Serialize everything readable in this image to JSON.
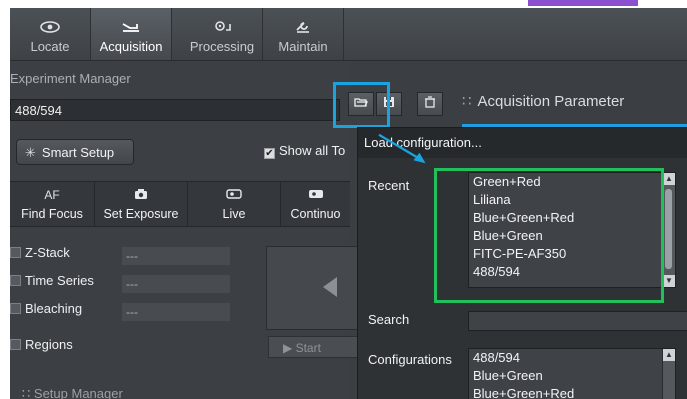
{
  "tabs": [
    {
      "label": "Locate",
      "icon": "eye-icon"
    },
    {
      "label": "Acquisition",
      "icon": "camera-arrow-icon"
    },
    {
      "label": "Processing",
      "icon": "gears-icon"
    },
    {
      "label": "Maintain",
      "icon": "wrench-icon"
    }
  ],
  "experiment_manager": {
    "title": "Experiment Manager",
    "value": "488/594"
  },
  "smart_setup_label": "Smart Setup",
  "show_all_label": "Show all To",
  "action_buttons": [
    {
      "top": "AF",
      "label": "Find Focus"
    },
    {
      "top": "",
      "label": "Set Exposure"
    },
    {
      "top": "",
      "label": "Live"
    },
    {
      "top": "",
      "label": "Continuo"
    }
  ],
  "options": [
    {
      "label": "Z-Stack",
      "value": "---"
    },
    {
      "label": "Time Series",
      "value": "---"
    },
    {
      "label": "Bleaching",
      "value": "---"
    },
    {
      "label": "Regions",
      "value": ""
    }
  ],
  "start_label": "Start",
  "setup_manager": "Setup Manager",
  "acquisition_parameter": "Acquisition Parameter",
  "popup": {
    "title": "Load configuration...",
    "recent_label": "Recent",
    "recent": [
      "Green+Red",
      "Liliana",
      "Blue+Green+Red",
      "Blue+Green",
      "FITC-PE-AF350",
      "488/594"
    ],
    "search_label": "Search",
    "configurations_label": "Configurations",
    "configurations": [
      "488/594",
      "Blue+Green",
      "Blue+Green+Red"
    ]
  },
  "colors": {
    "highlight_blue": "#19a4e0",
    "highlight_green": "#21c05a",
    "accent_purple": "#8b4fd0"
  }
}
